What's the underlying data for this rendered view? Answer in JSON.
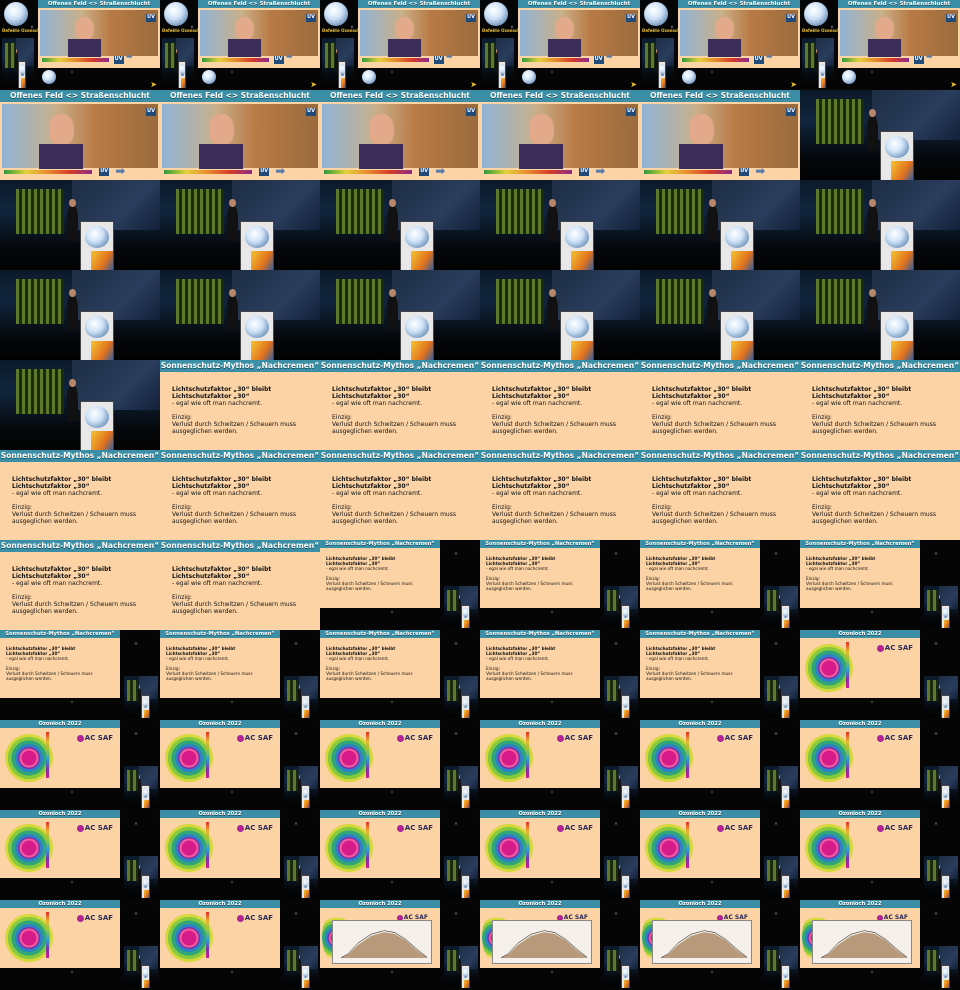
{
  "sheet": {
    "titles": {
      "offenes_feld": "Offenes Feld <> Straßenschlucht",
      "mythos": "Sonnenschutz-Mythos „Nachcremen“",
      "ozonloch": "Ozonloch 2022"
    },
    "mythos_text": {
      "line1": "Lichtschutzfaktor „30“ bleibt Lichtschutzfaktor „30“",
      "line2": "- egal wie oft man nachcremt.",
      "line3": "Einzig:",
      "line4": "Verlust durch Schwitzen / Scheuern muss",
      "line5": "ausgeglichen werden."
    },
    "uv_label": "UV",
    "acsaf_label": "AC SAF",
    "acsaf_small": "EUMETSAT",
    "logo_text": "Defekte Ozonschicht"
  },
  "colors": {
    "slide_bg": "#fcd3a5",
    "header_bg": "#3a8fa6",
    "page_bg": "#000000"
  }
}
